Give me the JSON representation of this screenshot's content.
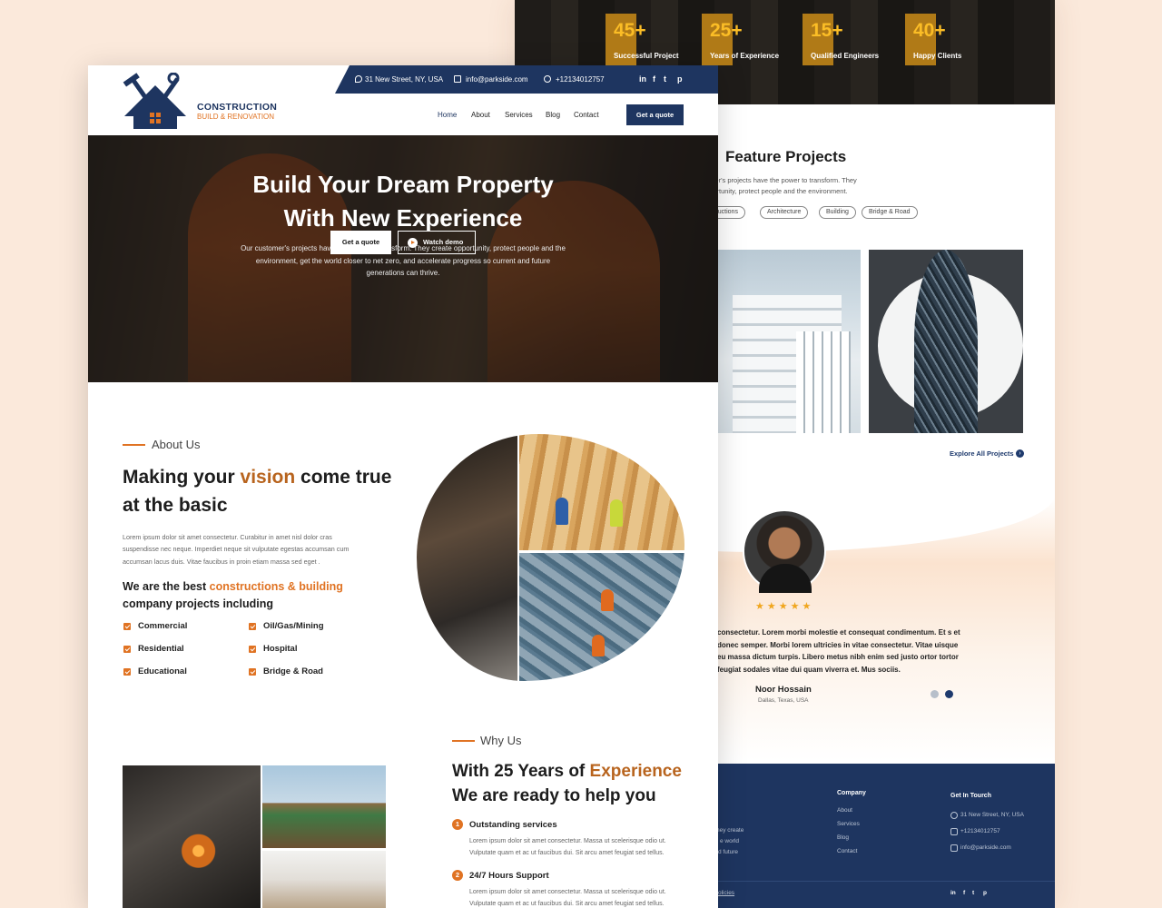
{
  "back_page": {
    "stats": [
      {
        "num": "45+",
        "label": "Successful Project"
      },
      {
        "num": "25+",
        "label": "Years of Experience"
      },
      {
        "num": "15+",
        "label": "Qualified Engineers"
      },
      {
        "num": "40+",
        "label": "Happy Clients"
      }
    ],
    "featured": {
      "title": "Feature Projects",
      "desc": "omer's projects have the power to transform. They pportunity, protect people and the environment.",
      "chips": [
        "structions",
        "Architecture",
        "Building",
        "Bridge & Road"
      ],
      "explore": "Explore All Projects"
    },
    "testimonial": {
      "stars": "★★★★★",
      "text": "consectetur. Lorem morbi molestie et consequat condimentum. Et s et donec semper. Morbi lorem ultricies in vitae consectetur. Vitae uisque eu massa dictum turpis. Libero metus nibh enim sed justo ortor tortor feugiat sodales vitae dui quam viverra et. Mus sociis.",
      "name": "Noor Hossain",
      "location": "Dallas, Texas, USA"
    },
    "footer": {
      "partial_text": [
        "hey create",
        "e world",
        "d future"
      ],
      "company_head": "Company",
      "company_links": [
        "About",
        "Services",
        "Blog",
        "Contact"
      ],
      "touch_head": "Get In Tourch",
      "touch_items": [
        "31 New Street, NY, USA",
        "+12134012757",
        "info@parkside.com"
      ],
      "policies": "olicies",
      "social": [
        "in",
        "f",
        "t",
        "p"
      ]
    }
  },
  "front_page": {
    "topbar": {
      "address": "31 New Street, NY, USA",
      "email": "info@parkside.com",
      "phone": "+12134012757",
      "social": [
        "in",
        "f",
        "t",
        "p"
      ]
    },
    "logo": {
      "title": "CONSTRUCTION",
      "subtitle": "BUILD & RENOVATION"
    },
    "nav": [
      "Home",
      "About",
      "Services",
      "Blog",
      "Contact"
    ],
    "quote_button": "Get a quote",
    "hero": {
      "title_line1": "Build Your Dream Property",
      "title_line2": "With New Experience",
      "desc": "Our customer's projects have the power to transform. They create  opportunity, protect people and the environment, get the world closer to net zero, and accelerate progress so current and future generations can thrive.",
      "btn_primary": "Get a quote",
      "btn_secondary": "Watch demo"
    },
    "about": {
      "eyebrow": "About Us",
      "title_a": "Making your ",
      "title_hl": "vision",
      "title_b": " come true at the basic",
      "desc": "Lorem ipsum dolor sit amet consectetur. Curabitur in amet nisl dolor cras suspendisse nec neque. Imperdiet neque sit vulputate egestas accumsan cum accumsan lacus duis. Vitae faucibus in proin etiam massa sed eget .",
      "sub_a": "We are the best ",
      "sub_hl1": "constructions &",
      "sub_hl2": "building",
      "sub_b": " company projects including",
      "checklist": [
        "Commercial",
        "Oil/Gas/Mining",
        "Residential",
        "Hospital",
        "Educational",
        "Bridge & Road"
      ]
    },
    "why": {
      "eyebrow": "Why Us",
      "title_a": "With 25 Years of ",
      "title_hl": "Experience",
      "title_b": "We are ready to help you",
      "items": [
        {
          "num": "1",
          "title": "Outstanding services",
          "desc": "Lorem ipsum dolor sit amet consectetur. Massa ut scelerisque odio ut. Vulputate quam et ac ut faucibus dui. Sit arcu amet feugiat sed tellus."
        },
        {
          "num": "2",
          "title": "24/7 Hours Support",
          "desc": "Lorem ipsum dolor sit amet consectetur. Massa ut scelerisque odio ut. Vulputate quam et ac ut faucibus dui. Sit arcu amet feugiat sed tellus."
        }
      ]
    }
  },
  "colors": {
    "navy": "#1e3560",
    "orange": "#e07323",
    "gold": "#fbbd26",
    "background": "#fbe9db"
  }
}
